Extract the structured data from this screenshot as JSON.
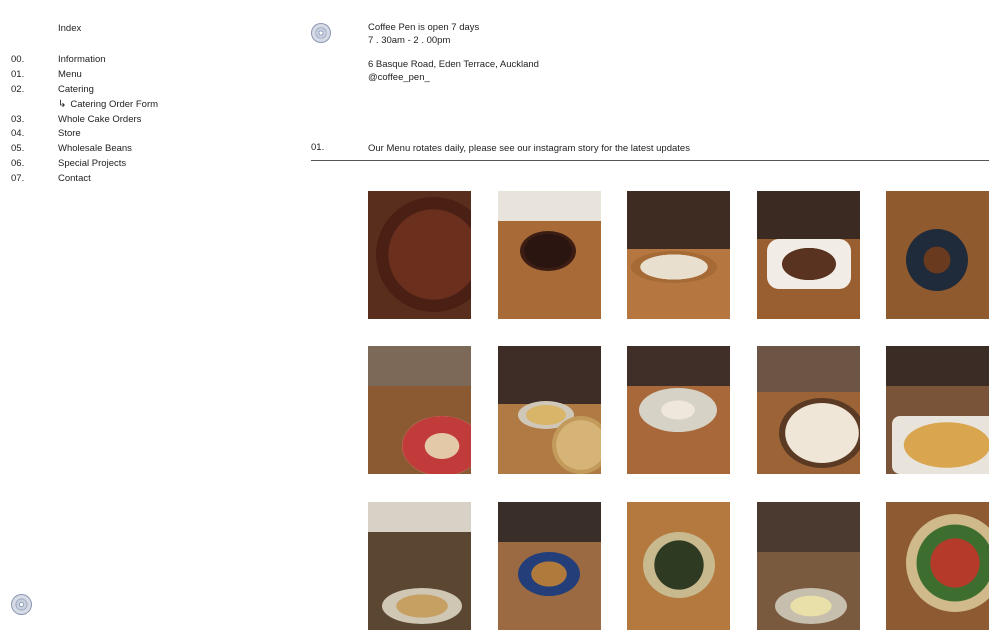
{
  "sidebar": {
    "index_label": "Index",
    "items": [
      {
        "num": "00.",
        "label": "Information"
      },
      {
        "num": "01.",
        "label": "Menu"
      },
      {
        "num": "02.",
        "label": "Catering"
      },
      {
        "num": "",
        "label": "Catering Order Form",
        "sub": true
      },
      {
        "num": "03.",
        "label": "Whole Cake Orders"
      },
      {
        "num": "04.",
        "label": "Store"
      },
      {
        "num": "05.",
        "label": "Wholesale Beans"
      },
      {
        "num": "06.",
        "label": "Special Projects"
      },
      {
        "num": "07.",
        "label": "Contact"
      }
    ],
    "sub_arrow_icon": "return-arrow-icon"
  },
  "header": {
    "hours_line1": "Coffee Pen is open 7 days",
    "hours_line2": "7 . 30am - 2 . 00pm",
    "address": "6 Basque Road, Eden Terrace, Auckland",
    "handle": "@coffee_pen_"
  },
  "section": {
    "num": "01.",
    "text_before": "Our Menu rotates daily, please see our ",
    "link_text": "instagram story",
    "text_after": " for the latest updates"
  },
  "photos": [
    {
      "desc": "chocolate-tart-topdown"
    },
    {
      "desc": "chocolate-cake-on-table"
    },
    {
      "desc": "cream-tart-hand"
    },
    {
      "desc": "loaf-cake-paper"
    },
    {
      "desc": "banana-bread-plate"
    },
    {
      "desc": "rhubarb-tart-slicing"
    },
    {
      "desc": "crumble-slice"
    },
    {
      "desc": "banoffee-pie-slice"
    },
    {
      "desc": "chocolate-cream-tart-cutting"
    },
    {
      "desc": "baked-crumble-tray"
    },
    {
      "desc": "savory-plate-fork"
    },
    {
      "desc": "pie-blue-bowl"
    },
    {
      "desc": "salad-bowl"
    },
    {
      "desc": "toast-plate-fork"
    },
    {
      "desc": "egg-salad-plate"
    }
  ],
  "colors": {
    "rule": "#555555",
    "seal": "#9aa7bf"
  }
}
